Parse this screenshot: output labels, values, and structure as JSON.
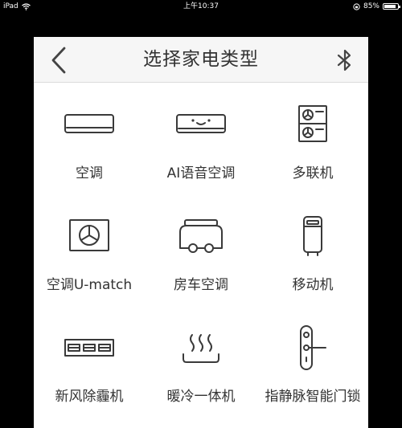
{
  "status_bar": {
    "device": "iPad",
    "time": "上午10:37",
    "battery_text": "85%",
    "battery_level": 0.85
  },
  "header": {
    "title": "选择家电类型"
  },
  "items": [
    {
      "label": "空调",
      "icon": "split-ac-icon"
    },
    {
      "label": "AI语音空调",
      "icon": "ai-voice-ac-icon"
    },
    {
      "label": "多联机",
      "icon": "multi-split-icon"
    },
    {
      "label": "空调U-match",
      "icon": "u-match-unit-icon"
    },
    {
      "label": "房车空调",
      "icon": "rv-icon"
    },
    {
      "label": "移动机",
      "icon": "portable-ac-icon"
    },
    {
      "label": "新风除霾机",
      "icon": "fresh-air-unit-icon"
    },
    {
      "label": "暖冷一体机",
      "icon": "heat-cool-icon"
    },
    {
      "label": "指静脉智能门锁",
      "icon": "smart-lock-icon"
    }
  ],
  "colors": {
    "header_bg": "#f6f6f6",
    "text": "#333333",
    "icon_stroke": "#3a3a3a",
    "backdrop": "#000000"
  }
}
